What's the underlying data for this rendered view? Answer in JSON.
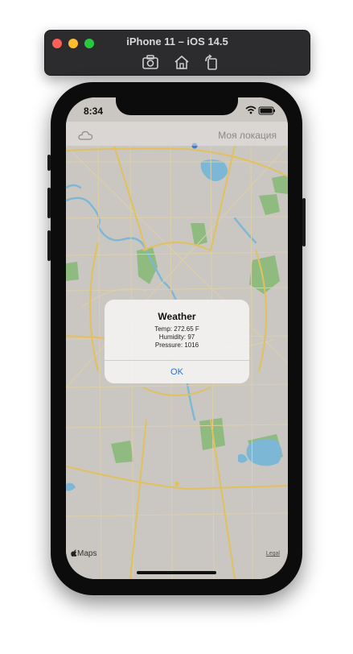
{
  "simulator": {
    "title": "iPhone 11 – iOS 14.5",
    "toolbar_icons": [
      "screenshot-icon",
      "home-icon",
      "rotate-icon"
    ]
  },
  "status_bar": {
    "time": "8:34"
  },
  "header": {
    "location_label": "Моя локация",
    "left_icon": "cloud-icon"
  },
  "alert": {
    "title": "Weather",
    "lines": [
      "Temp: 272.65 F",
      "Humidity: 97",
      "Pressure: 1016"
    ],
    "ok_label": "OK"
  },
  "map": {
    "logo_text": "Maps",
    "legal_label": "Legal"
  },
  "colors": {
    "accent": "#1b74e4",
    "map_background": "#cac6c1",
    "water": "#7cb8d6",
    "park": "#8fba80",
    "major_road": "#e2c15c",
    "minor_road": "#ddd0a7"
  }
}
